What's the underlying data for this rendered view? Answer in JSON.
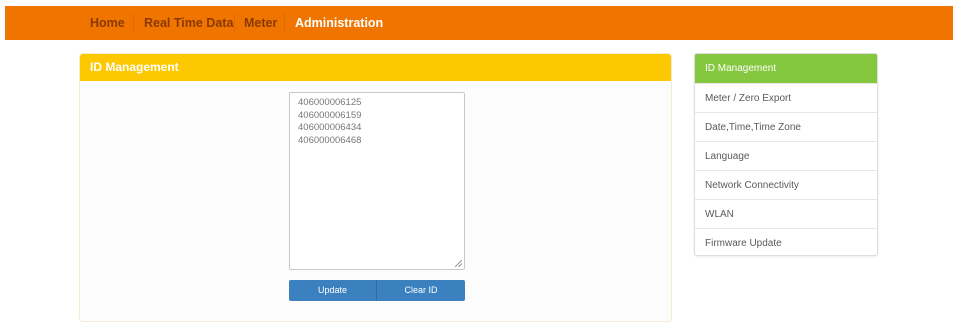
{
  "nav": {
    "items": [
      {
        "label": "Home",
        "active": false
      },
      {
        "label": "Real Time Data",
        "active": false
      },
      {
        "label": "Meter",
        "active": false
      },
      {
        "label": "Administration",
        "active": true
      }
    ]
  },
  "panel": {
    "title": "ID Management",
    "ids": [
      "406000006125",
      "406000006159",
      "406000006434",
      "406000006468"
    ],
    "update_label": "Update",
    "clear_label": "Clear ID"
  },
  "sidebar": {
    "items": [
      {
        "label": "ID Management",
        "active": true
      },
      {
        "label": "Meter / Zero Export",
        "active": false
      },
      {
        "label": "Date,Time,Time Zone",
        "active": false
      },
      {
        "label": "Language",
        "active": false
      },
      {
        "label": "Network Connectivity",
        "active": false
      },
      {
        "label": "WLAN",
        "active": false
      },
      {
        "label": "Firmware Update",
        "active": false
      }
    ]
  },
  "colors": {
    "topbar": "#f07400",
    "panel_header": "#fdc800",
    "button": "#3b80bf",
    "sidebar_active": "#85c73f"
  }
}
